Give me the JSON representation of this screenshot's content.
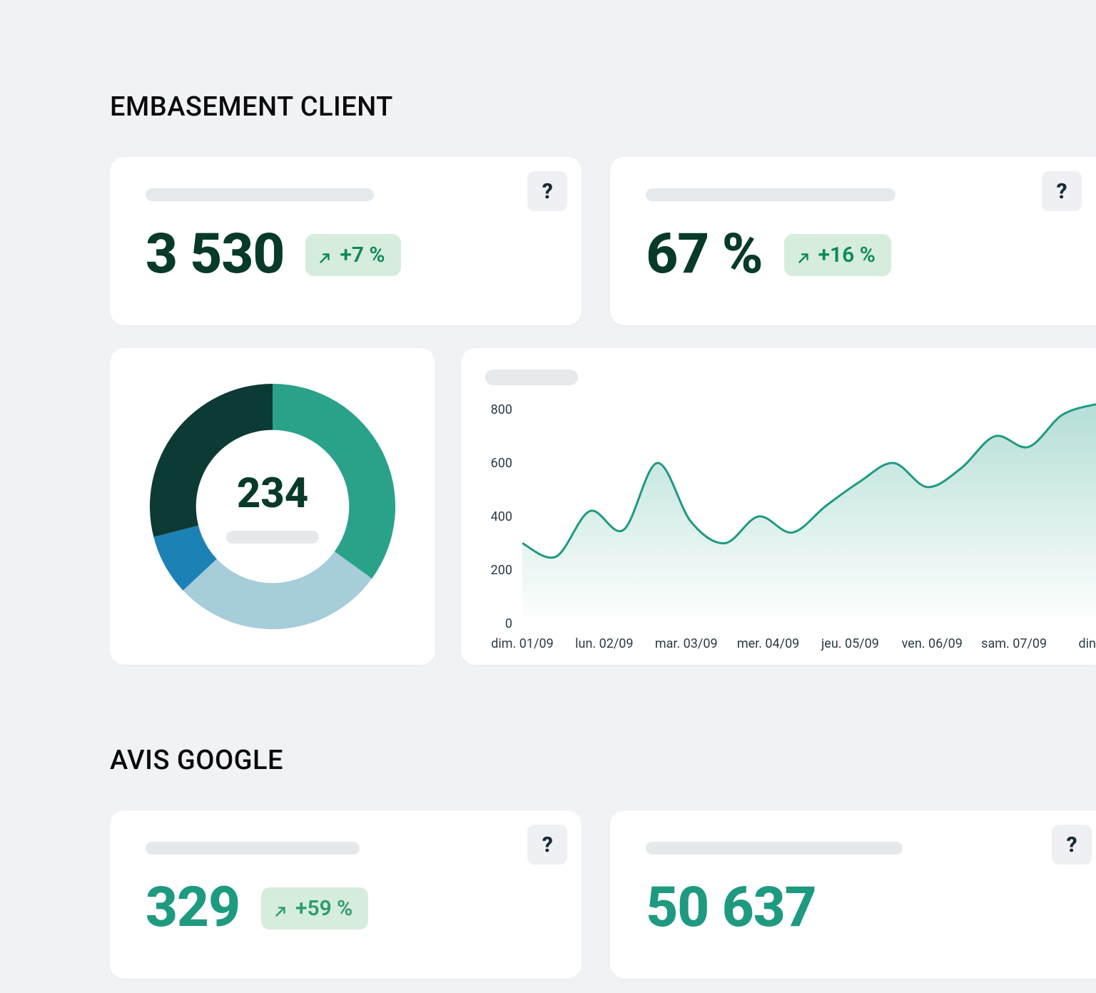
{
  "sections": {
    "embasement": {
      "title": "EMBASEMENT CLIENT"
    },
    "avis": {
      "title": "AVIS GOOGLE"
    }
  },
  "kpis": {
    "embasement_count": {
      "value": "3 530",
      "trend": "+7 %"
    },
    "embasement_rate": {
      "value": "67 %",
      "trend": "+16 %"
    },
    "donut_total": {
      "value": "234"
    },
    "avis_count": {
      "value": "329",
      "trend": "+59 %"
    },
    "avis_views": {
      "value": "50 637"
    }
  },
  "help_icon": "?",
  "chart_data": [
    {
      "type": "pie",
      "title": "",
      "series": [
        {
          "name": "segment-teal",
          "value": 35,
          "color": "#2aa28a"
        },
        {
          "name": "segment-lightblue",
          "value": 28,
          "color": "#a6cdd9"
        },
        {
          "name": "segment-blue",
          "value": 8,
          "color": "#1c82b5"
        },
        {
          "name": "segment-dark",
          "value": 29,
          "color": "#0c3a34"
        }
      ],
      "center_value": 234
    },
    {
      "type": "area",
      "title": "",
      "xlabel": "",
      "ylabel": "",
      "ylim": [
        0,
        800
      ],
      "yticks": [
        0,
        200,
        400,
        600,
        800
      ],
      "categories": [
        "dim. 01/09",
        "lun. 02/09",
        "mar. 03/09",
        "mer. 04/09",
        "jeu. 05/09",
        "ven. 06/09",
        "sam. 07/09",
        "din"
      ],
      "values": [
        300,
        250,
        420,
        350,
        600,
        380,
        300,
        400,
        340,
        440,
        530,
        600,
        510,
        580,
        700,
        660,
        780,
        820
      ]
    }
  ]
}
